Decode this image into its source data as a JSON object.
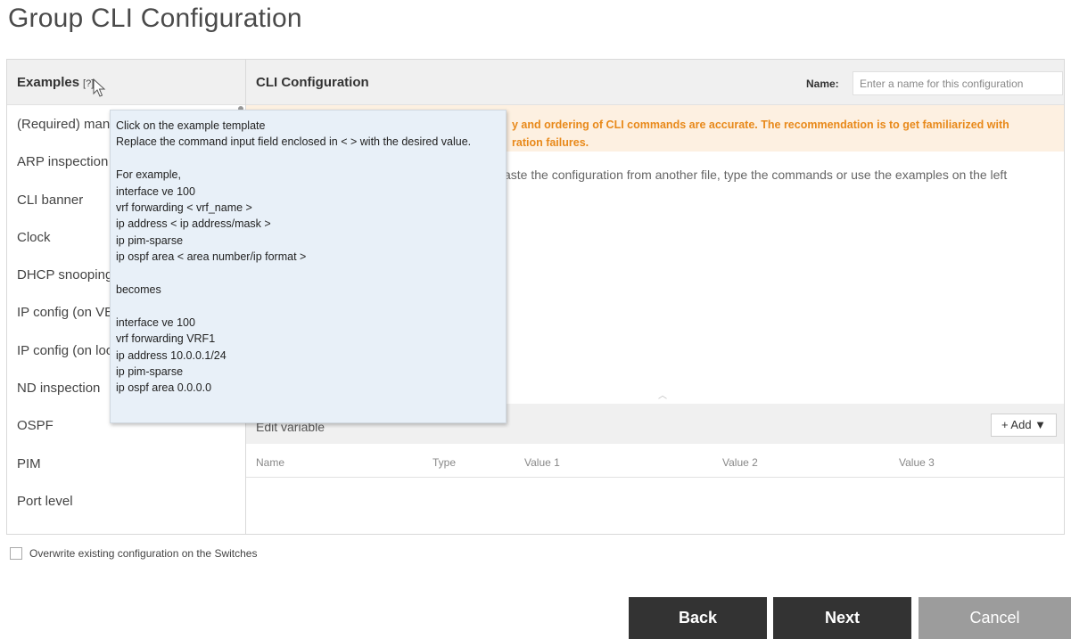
{
  "page": {
    "title": "Group CLI Configuration"
  },
  "examples": {
    "header": "Examples",
    "help": "[?]",
    "items": [
      "(Required) management",
      "ARP inspection",
      "CLI banner",
      "Clock",
      "DHCP snooping",
      "IP config (on VE)",
      "IP config (on loopback)",
      "ND inspection",
      "OSPF",
      "PIM",
      "Port level"
    ]
  },
  "cli": {
    "title": "CLI Configuration",
    "name_label": "Name:",
    "name_placeholder": "Enter a name for this configuration",
    "warning_line1": "y and ordering of CLI commands are accurate. The recommendation is to get familiarized with",
    "warning_line2": "ration failures.",
    "editor_placeholder": "aste the configuration from another file, type the commands or use the examples on the left"
  },
  "edit_variable": {
    "title": "Edit variable",
    "add_label": "+ Add ▼",
    "columns": [
      "Name",
      "Type",
      "Value 1",
      "Value 2",
      "Value 3"
    ]
  },
  "overwrite": {
    "label": "Overwrite existing configuration on the Switches"
  },
  "buttons": {
    "back": "Back",
    "next": "Next",
    "cancel": "Cancel"
  },
  "tooltip": {
    "lines": [
      "Click on the example template",
      "Replace the command input field enclosed in < > with the desired value.",
      "",
      "For example,",
      "interface ve 100",
      "vrf forwarding < vrf_name >",
      "ip address < ip address/mask >",
      "ip pim-sparse",
      "ip ospf area < area number/ip format >",
      "",
      "becomes",
      "",
      "interface ve 100",
      "vrf forwarding VRF1",
      "ip address 10.0.0.1/24",
      "ip pim-sparse",
      "ip ospf area 0.0.0.0"
    ]
  }
}
